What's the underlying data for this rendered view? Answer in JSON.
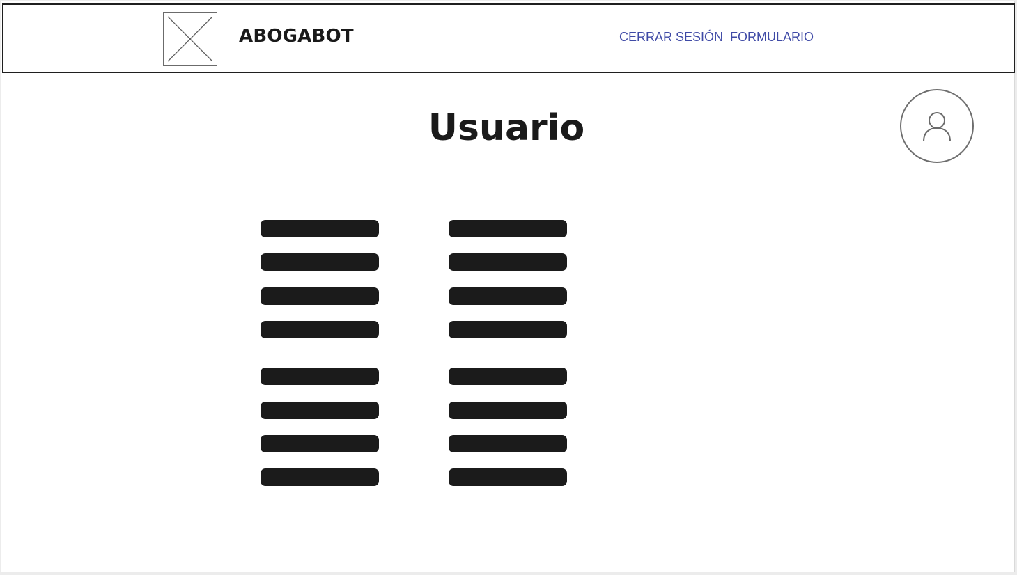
{
  "header": {
    "logo_icon": "image-placeholder-icon",
    "brand": "ABOGABOT",
    "nav": {
      "logout_label": "CERRAR SESIÓN",
      "form_label": "FORMULARIO"
    }
  },
  "main": {
    "title": "Usuario",
    "avatar_icon": "user-icon",
    "field_groups": [
      {
        "column": "left",
        "placeholders": 4
      },
      {
        "column": "right",
        "placeholders": 4
      },
      {
        "column": "left",
        "placeholders": 4
      },
      {
        "column": "right",
        "placeholders": 4
      }
    ]
  },
  "colors": {
    "link": "#3f4aa6",
    "text": "#1a1a1a",
    "placeholder_bar": "#1b1b1b",
    "border": "#1f1f1f"
  }
}
